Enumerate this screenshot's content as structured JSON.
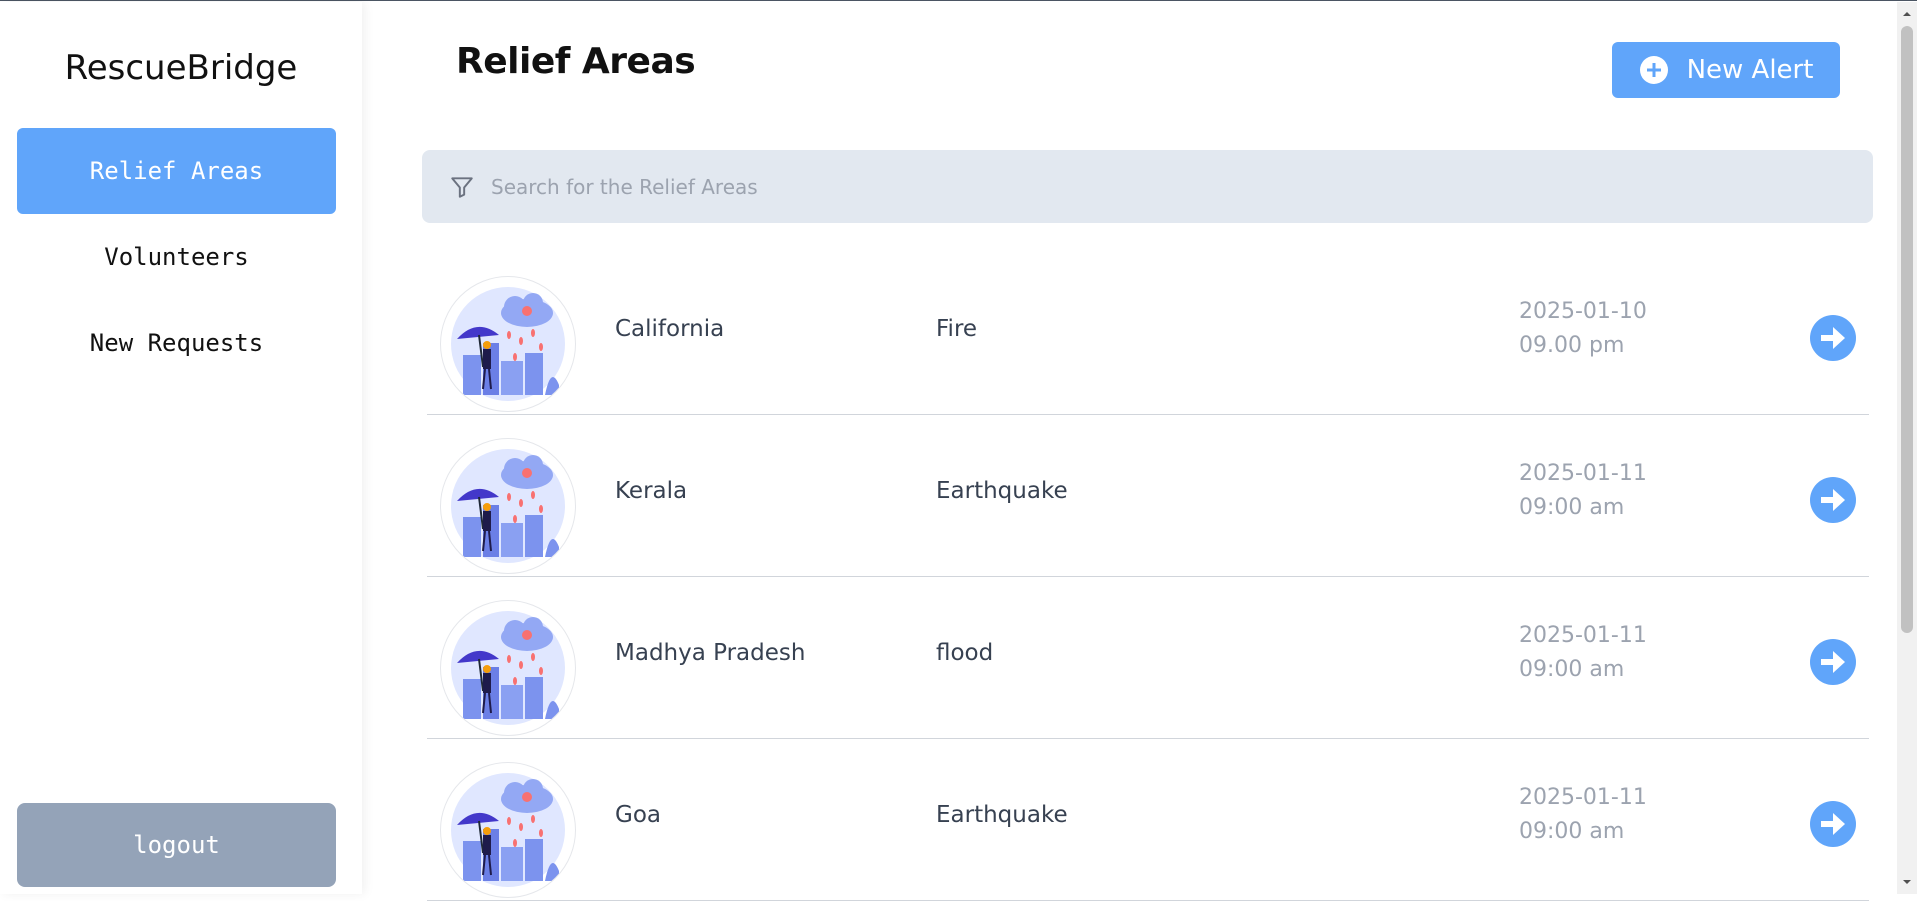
{
  "sidebar": {
    "brand": "RescueBridge",
    "items": [
      {
        "label": "Relief Areas",
        "active": true
      },
      {
        "label": "Volunteers",
        "active": false
      },
      {
        "label": "New Requests",
        "active": false
      }
    ],
    "logout_label": "logout"
  },
  "header": {
    "title": "Relief Areas",
    "new_alert_label": "New Alert"
  },
  "search": {
    "placeholder": "Search for the Relief Areas",
    "value": ""
  },
  "areas": [
    {
      "name": "California",
      "type": "Fire",
      "date": "2025-01-10",
      "time": "09.00 pm"
    },
    {
      "name": "Kerala",
      "type": "Earthquake",
      "date": "2025-01-11",
      "time": "09:00 am"
    },
    {
      "name": "Madhya Pradesh",
      "type": "flood",
      "date": "2025-01-11",
      "time": "09:00 am"
    },
    {
      "name": "Goa",
      "type": "Earthquake",
      "date": "2025-01-11",
      "time": "09:00 am"
    }
  ],
  "icons": {
    "new_alert": "plus-circle-icon",
    "search": "filter-icon",
    "row_action": "arrow-right-circle-icon",
    "row_thumb": "rain-umbrella-illustration"
  },
  "colors": {
    "accent": "#60a5fa",
    "logout": "#94a3b8",
    "search_bg": "#e2e8f0",
    "muted_text": "#9ca3af"
  }
}
